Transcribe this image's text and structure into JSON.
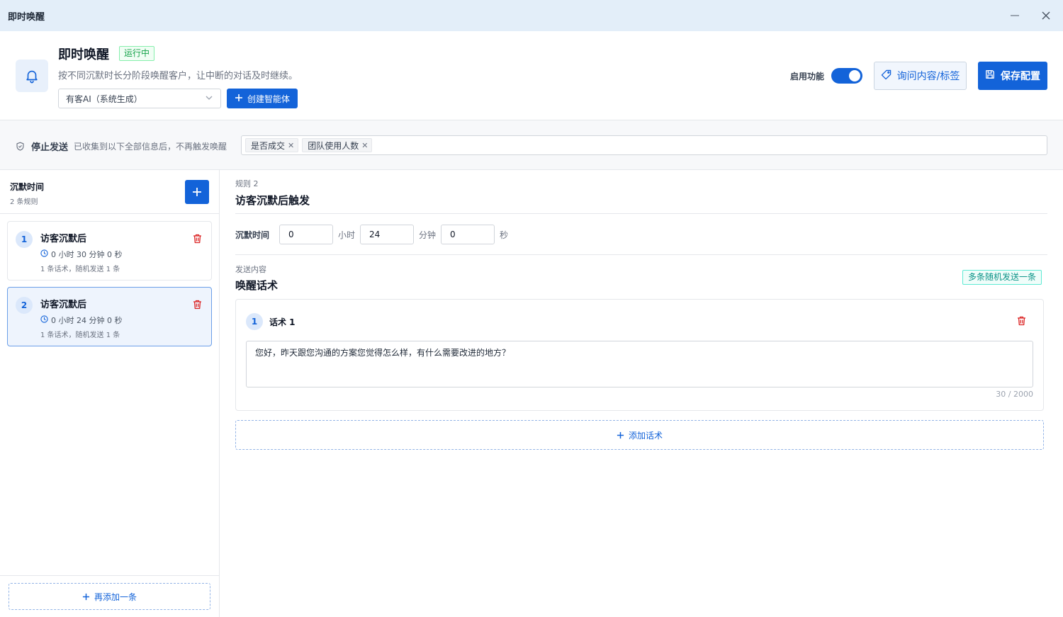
{
  "window": {
    "title": "即时唤醒"
  },
  "header": {
    "title": "即时唤醒",
    "status_badge": "运行中",
    "description": "按不同沉默时长分阶段唤醒客户，让中断的对话及时继续。",
    "agent_select": {
      "value": "有客AI（系统生成）"
    },
    "create_agent_label": "创建智能体",
    "enable_label": "启用功能",
    "enable_on": true,
    "inquiry_label": "询问内容/标签",
    "save_label": "保存配置"
  },
  "stop_bar": {
    "title": "停止发送",
    "description": "已收集到以下全部信息后，不再触发唤醒",
    "tags": [
      "是否成交",
      "团队使用人数"
    ]
  },
  "left_panel": {
    "title": "沉默时间",
    "count": "2 条规则",
    "rules": [
      {
        "index": "1",
        "title": "访客沉默后",
        "time": "0 小时 30 分钟 0 秒",
        "meta": "1 条话术，随机发送 1 条",
        "active": false
      },
      {
        "index": "2",
        "title": "访客沉默后",
        "time": "0 小时 24 分钟 0 秒",
        "meta": "1 条话术，随机发送 1 条",
        "active": true
      }
    ],
    "add_more_label": "再添加一条"
  },
  "detail": {
    "rule_label": "规则 2",
    "rule_title": "访客沉默后触发",
    "silence_label": "沉默时间",
    "hours": "0",
    "hours_unit": "小时",
    "minutes": "24",
    "minutes_unit": "分钟",
    "seconds": "0",
    "seconds_unit": "秒",
    "send_label": "发送内容",
    "send_title": "唤醒话术",
    "random_badge": "多条随机发送一条",
    "scripts": [
      {
        "index": "1",
        "title": "话术 1",
        "text": "您好，昨天跟您沟通的方案您觉得怎么样，有什么需要改进的地方？",
        "count": "30 / 2000"
      }
    ],
    "add_script_label": "添加话术"
  },
  "colors": {
    "primary": "#1363d9",
    "success": "#16a34a",
    "danger": "#dc2626",
    "teal": "#0d9488"
  }
}
